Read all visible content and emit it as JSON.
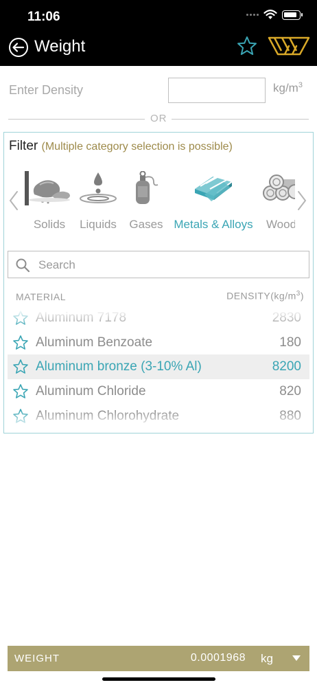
{
  "status": {
    "time": "11:06"
  },
  "nav": {
    "title": "Weight"
  },
  "density": {
    "label": "Enter Density",
    "value": "",
    "unit": "kg/m",
    "unit_exp": "3"
  },
  "divider": {
    "text": "OR"
  },
  "filter": {
    "title": "Filter",
    "hint": "(Multiple category selection is possible)",
    "categories": [
      {
        "label": "Solids",
        "icon": "solids-icon"
      },
      {
        "label": "Liquids",
        "icon": "liquids-icon"
      },
      {
        "label": "Gases",
        "icon": "gases-icon"
      },
      {
        "label": "Metals & Alloys",
        "icon": "metals-icon",
        "active": true
      },
      {
        "label": "Wood",
        "icon": "wood-icon"
      }
    ]
  },
  "search": {
    "placeholder": "Search",
    "value": ""
  },
  "table": {
    "col_material": "MATERIAL",
    "col_density": "DENSITY(kg/m",
    "col_density_exp": "3",
    "col_density_close": ")",
    "rows": [
      {
        "name": "Aluminum 7178",
        "density": "2830"
      },
      {
        "name": "Aluminum Benzoate",
        "density": "180"
      },
      {
        "name": "Aluminum bronze (3-10% Al)",
        "density": "8200",
        "selected": true
      },
      {
        "name": "Aluminum Chloride",
        "density": "820"
      },
      {
        "name": "Aluminum Chlorohydrate",
        "density": "880"
      }
    ]
  },
  "result": {
    "label": "WEIGHT",
    "value": "0.0001968",
    "unit": "kg"
  },
  "colors": {
    "accent": "#3aa5b4",
    "gold": "#ada472",
    "hint": "#9d8a4a"
  }
}
